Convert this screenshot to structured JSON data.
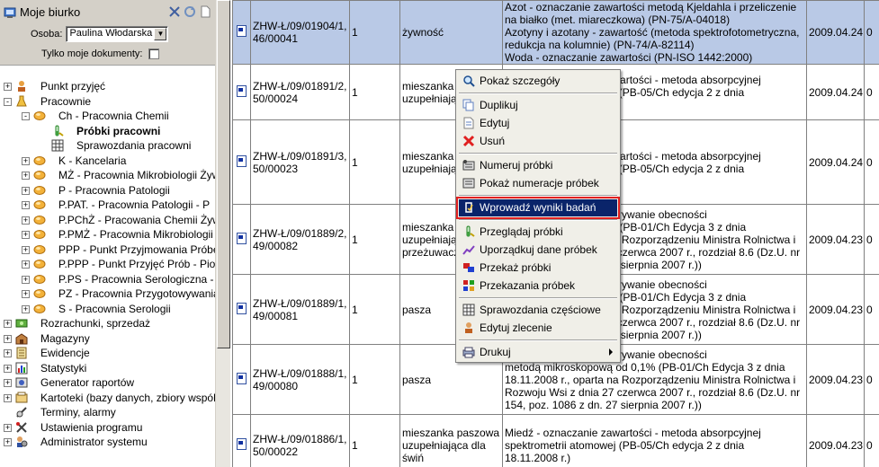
{
  "left_panel": {
    "title": "Moje biurko",
    "osoba_label": "Osoba:",
    "osoba_value": "Paulina Włodarska",
    "tylko_label": "Tylko moje dokumenty:",
    "tree": [
      {
        "label": "Punkt przyjęć",
        "level": 0,
        "exp": "+",
        "icon": "reception-icon"
      },
      {
        "label": "Pracownie",
        "level": 0,
        "exp": "-",
        "icon": "lab-flask-icon"
      },
      {
        "label": "Ch - Pracownia Chemii",
        "level": 1,
        "exp": "-",
        "icon": "oval-icon"
      },
      {
        "label": "Próbki pracowni",
        "level": 2,
        "exp": "",
        "icon": "sample-tube-icon",
        "bold": true
      },
      {
        "label": "Sprawozdania pracowni",
        "level": 2,
        "exp": "",
        "icon": "report-grid-icon"
      },
      {
        "label": "K - Kancelaria",
        "level": 1,
        "exp": "+",
        "icon": "oval-icon"
      },
      {
        "label": "MŻ - Pracownia Mikrobiologii Żywności",
        "level": 1,
        "exp": "+",
        "icon": "oval-icon"
      },
      {
        "label": "P - Pracownia Patologii",
        "level": 1,
        "exp": "+",
        "icon": "oval-icon"
      },
      {
        "label": "P.PAT. - Pracownia Patologii - P",
        "level": 1,
        "exp": "+",
        "icon": "oval-icon"
      },
      {
        "label": "P.PChŻ - Pracowania Chemii Żywności",
        "level": 1,
        "exp": "+",
        "icon": "oval-icon"
      },
      {
        "label": "P.PMŻ - Pracownia Mikrobiologii Żywności",
        "level": 1,
        "exp": "+",
        "icon": "oval-icon"
      },
      {
        "label": "PPP - Punkt Przyjmowania Próbek",
        "level": 1,
        "exp": "+",
        "icon": "oval-icon"
      },
      {
        "label": "P.PPP - Punkt Przyjęć Prób - Pio",
        "level": 1,
        "exp": "+",
        "icon": "oval-icon"
      },
      {
        "label": "P.PS - Pracownia Serologiczna - P",
        "level": 1,
        "exp": "+",
        "icon": "oval-icon"
      },
      {
        "label": "PZ - Pracownia Przygotowywania",
        "level": 1,
        "exp": "+",
        "icon": "oval-icon"
      },
      {
        "label": "S - Pracownia Serologii",
        "level": 1,
        "exp": "+",
        "icon": "oval-icon"
      },
      {
        "label": "Rozrachunki, sprzedaż",
        "level": 0,
        "exp": "+",
        "icon": "money-icon"
      },
      {
        "label": "Magazyny",
        "level": 0,
        "exp": "+",
        "icon": "warehouse-icon"
      },
      {
        "label": "Ewidencje",
        "level": 0,
        "exp": "+",
        "icon": "records-icon"
      },
      {
        "label": "Statystyki",
        "level": 0,
        "exp": "+",
        "icon": "stats-icon"
      },
      {
        "label": "Generator raportów",
        "level": 0,
        "exp": "+",
        "icon": "report-gen-icon"
      },
      {
        "label": "Kartoteki (bazy danych, zbiory wspólne)",
        "level": 0,
        "exp": "+",
        "icon": "card-file-icon"
      },
      {
        "label": "Terminy, alarmy",
        "level": 0,
        "exp": "",
        "icon": "alarm-icon"
      },
      {
        "label": "Ustawienia programu",
        "level": 0,
        "exp": "+",
        "icon": "settings-tools-icon"
      },
      {
        "label": "Administrator systemu",
        "level": 0,
        "exp": "+",
        "icon": "admin-icon"
      }
    ]
  },
  "grid": {
    "rows": [
      {
        "num": "ZHW-Ł/09/01904/1, 46/00041",
        "qty": "1",
        "kind": "żywność",
        "desc": [
          "Azot - oznaczanie zawartości metodą Kjeldahla i przeliczenie",
          "na białko (met. miareczkowa) (PN-75/A-04018)",
          "Azotyny i azotany - zawartość (metoda spektrofotometryczna,",
          "redukcja na kolumnie) (PN-74/A-82114)",
          "Woda - oznaczanie zawartości (PN-ISO 1442:2000)"
        ],
        "date": "2009.04.24",
        "last": "0",
        "selected": true,
        "height": 71
      },
      {
        "num": "ZHW-Ł/09/01891/2, 50/00024",
        "qty": "1",
        "kind": "mieszanka paszowa uzupełniają świń",
        "desc": [
          "Miedź - oznaczanie zawartości - metoda absorpcyjnej",
          "spektrometrii atomowej (PB-05/Ch edycja 2 z dnia",
          ""
        ],
        "date": "2009.04.24",
        "last": "0",
        "selected": false,
        "height": 62
      },
      {
        "num": "ZHW-Ł/09/01891/3, 50/00023",
        "qty": "1",
        "kind": "mieszanka paszowa uzupełniają świń",
        "desc": [
          "",
          "Miedź - oznaczanie zawartości - metoda absorpcyjnej",
          "spektrometrii atomowej (PB-05/Ch edycja 2 z dnia",
          ""
        ],
        "date": "2009.04.24",
        "last": "0",
        "selected": false,
        "height": 94
      },
      {
        "num": "ZHW-Ł/09/01889/2, 49/00082",
        "qty": "1",
        "kind": "mieszanka paszowa uzupełniają przeżuwacz",
        "desc": [
          "Zanieczyszczenia - wykrywanie obecności",
          "mikroskopową od 0,1% (PB-01/Ch Edycja 3 z dnia",
          "18.11.2008 r., oparta na Rozporządzeniu Ministra Rolnictwa i",
          "Rozwoju Wsi z dnia 27 czerwca 2007 r., rozdział 8.6 (Dz.U. nr",
          "154, poz. 1086 z dn. 27 sierpnia 2007 r.))"
        ],
        "date": "2009.04.23",
        "last": "0",
        "selected": false,
        "height": 78
      },
      {
        "num": "ZHW-Ł/09/01889/1, 49/00081",
        "qty": "1",
        "kind": "pasza",
        "desc": [
          "Zanieczyszczenia - wykrywanie obecności",
          "mikroskopową od 0,1% (PB-01/Ch Edycja 3 z dnia",
          "18.11.2008 r., oparta na Rozporządzeniu Ministra Rolnictwa i",
          "Rozwoju Wsi z dnia 27 czerwca 2007 r., rozdział 8.6 (Dz.U. nr",
          "154, poz. 1086 z dn. 27 sierpnia 2007 r.))"
        ],
        "date": "2009.04.23",
        "last": "0",
        "selected": false,
        "height": 78
      },
      {
        "num": "ZHW-Ł/09/01888/1, 49/00080",
        "qty": "1",
        "kind": "pasza",
        "desc": [
          "Zanieczyszczenia - wykrywanie obecności",
          "metodą mikroskopową od 0,1% (PB-01/Ch Edycja 3 z dnia",
          "18.11.2008 r., oparta na Rozporządzeniu Ministra Rolnictwa i",
          "Rozwoju Wsi z dnia 27 czerwca 2007 r., rozdział 8.6 (Dz.U. nr",
          "154, poz. 1086 z dn. 27 sierpnia 2007 r.))"
        ],
        "date": "2009.04.23",
        "last": "0",
        "selected": false,
        "height": 78
      },
      {
        "num": "ZHW-Ł/09/01886/1, 50/00022",
        "qty": "1",
        "kind": "mieszanka paszowa uzupełniająca dla świń",
        "desc": [
          "Miedź - oznaczanie zawartości - metoda absorpcyjnej",
          "spektrometrii atomowej (PB-05/Ch edycja 2 z dnia",
          "18.11.2008 r.)"
        ],
        "date": "2009.04.23",
        "last": "0",
        "selected": false,
        "height": 68
      }
    ]
  },
  "context_menu": {
    "items": [
      {
        "type": "item",
        "label": "Pokaż szczegóły",
        "icon": "magnifier-icon",
        "name": "menu-show-details"
      },
      {
        "type": "sep"
      },
      {
        "type": "item",
        "label": "Duplikuj",
        "icon": "duplicate-icon",
        "name": "menu-duplicate"
      },
      {
        "type": "item",
        "label": "Edytuj",
        "icon": "edit-doc-icon",
        "name": "menu-edit"
      },
      {
        "type": "item",
        "label": "Usuń",
        "icon": "delete-x-icon",
        "name": "menu-delete"
      },
      {
        "type": "sep"
      },
      {
        "type": "item",
        "label": "Numeruj próbki",
        "icon": "numbering-icon",
        "name": "menu-number-samples"
      },
      {
        "type": "item",
        "label": "Pokaż numeracje próbek",
        "icon": "numbering-list-icon",
        "name": "menu-show-numbering"
      },
      {
        "type": "sep"
      },
      {
        "type": "item",
        "label": "Wprowadź wyniki badań",
        "icon": "enter-results-icon",
        "name": "menu-enter-results",
        "active": true
      },
      {
        "type": "sep"
      },
      {
        "type": "item",
        "label": "Przeglądaj próbki",
        "icon": "sample-tube-icon",
        "name": "menu-browse-samples"
      },
      {
        "type": "item",
        "label": "Uporządkuj dane próbek",
        "icon": "sort-chart-icon",
        "name": "menu-organize-sample-data"
      },
      {
        "type": "item",
        "label": "Przekaż próbki",
        "icon": "transfer-icon",
        "name": "menu-transfer-samples"
      },
      {
        "type": "item",
        "label": "Przekazania próbek",
        "icon": "transfers-list-icon",
        "name": "menu-sample-transfers"
      },
      {
        "type": "sep"
      },
      {
        "type": "item",
        "label": "Sprawozdania częściowe",
        "icon": "report-grid-icon",
        "name": "menu-partial-reports"
      },
      {
        "type": "item",
        "label": "Edytuj zlecenie",
        "icon": "edit-order-icon",
        "name": "menu-edit-order"
      },
      {
        "type": "sep"
      },
      {
        "type": "item",
        "label": "Drukuj",
        "icon": "printer-icon",
        "name": "menu-print",
        "submenu": true
      }
    ]
  }
}
